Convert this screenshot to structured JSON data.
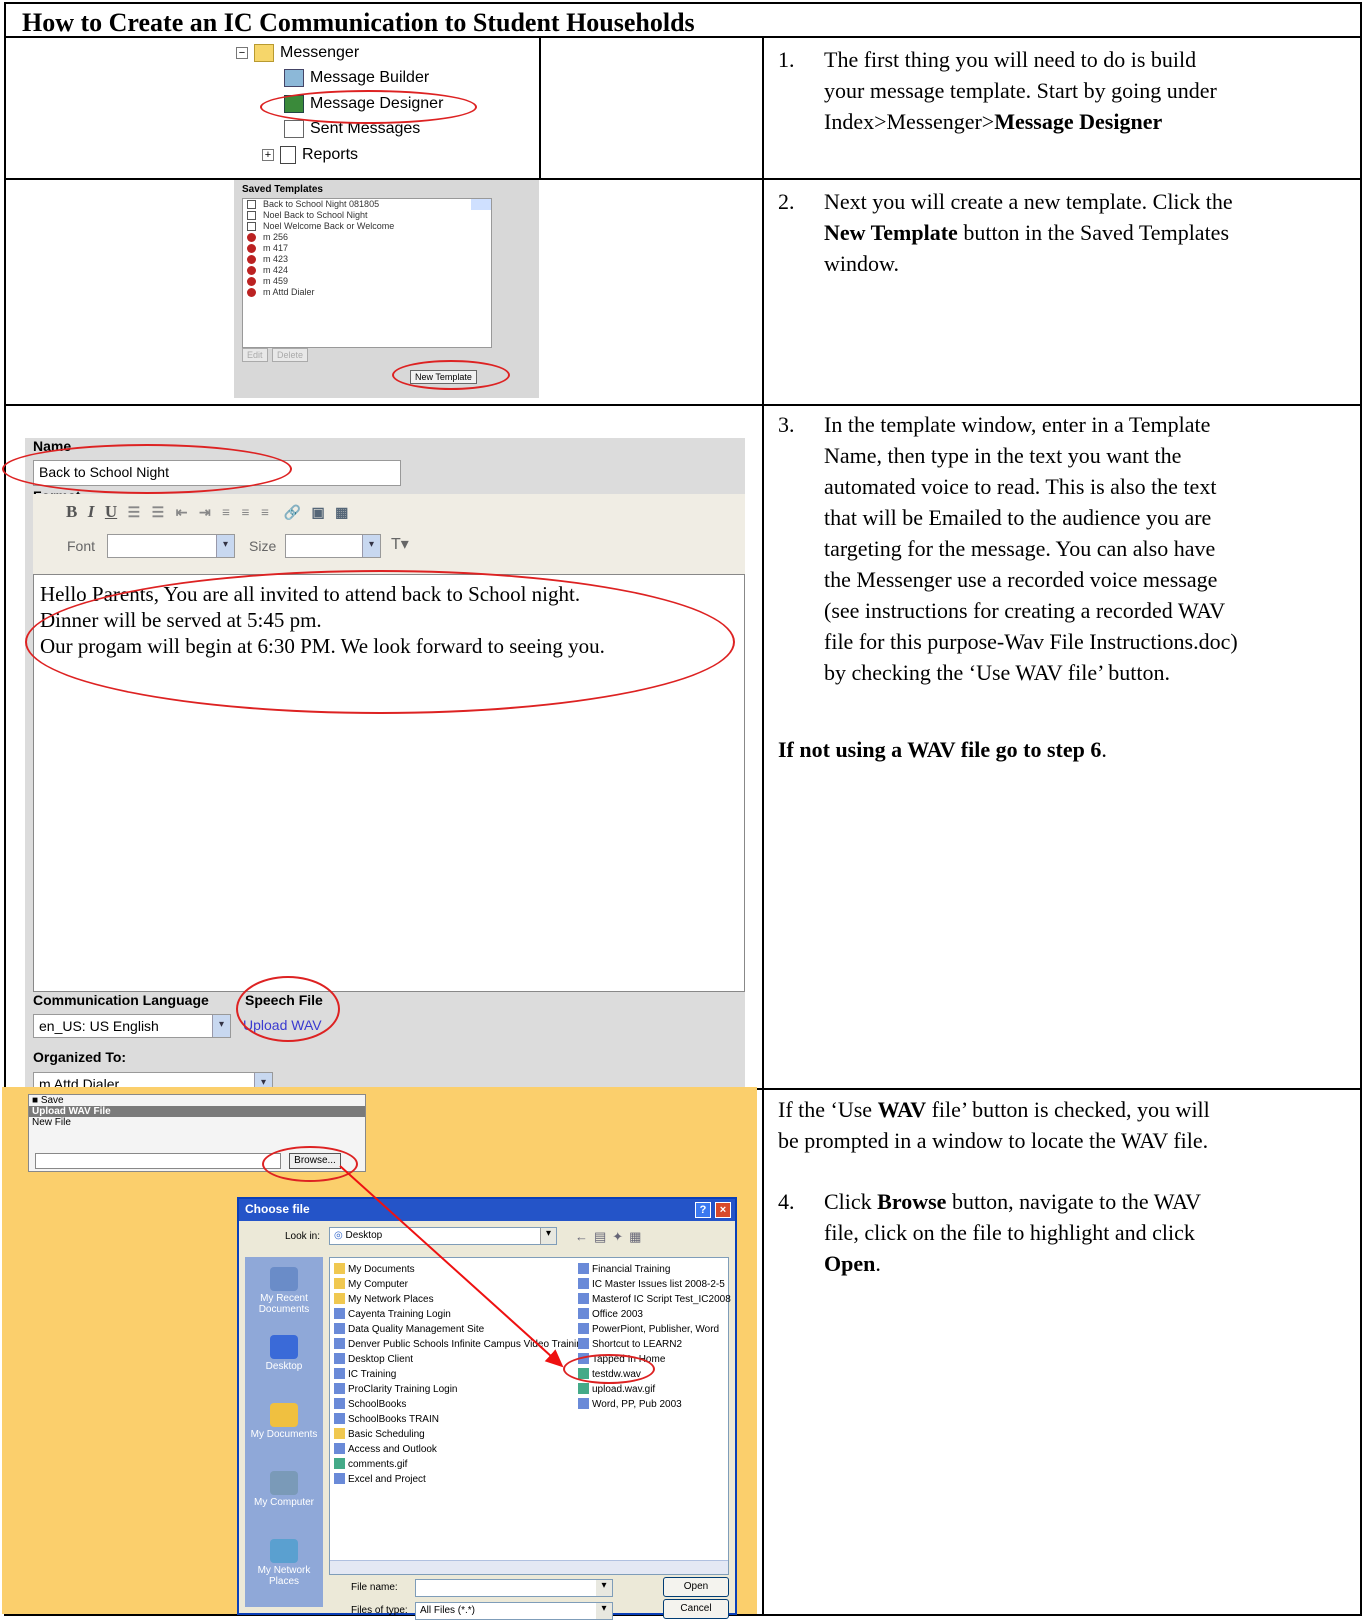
{
  "title": "How to Create an IC Communication to Student Households",
  "steps": {
    "s1": {
      "num": "1.",
      "line1": "The first thing you will need to do is build",
      "line2": "your message template.  Start by going under",
      "line3a": "Index>Messenger>",
      "line3b": "Message Designer"
    },
    "s2": {
      "num": "2.",
      "line1": "Next you will create a new template.  Click the",
      "line2b": "New Template",
      "line2a": " button in the Saved Templates",
      "line3": "window."
    },
    "s3": {
      "num": "3.",
      "lines": [
        "In the template window, enter in a Template",
        "Name, then type in the text you want the",
        "automated voice to read.  This is also the text",
        "that will be Emailed to the audience you are",
        "targeting for the message.  You can also have",
        "the Messenger use a recorded voice message",
        "(see instructions for creating a recorded WAV",
        "file for this purpose-Wav File Instructions.doc)",
        "by checking the ‘Use WAV file’ button."
      ],
      "note_bold": "If not using a WAV file go to step 6",
      "note_end": "."
    },
    "s4pre": {
      "a": "If the ‘Use ",
      "b": "WAV",
      "c": " file’ button is checked, you will",
      "line2": "be prompted in a window to locate the WAV file."
    },
    "s4": {
      "num": "4.",
      "a": "Click ",
      "b": "Browse",
      "c": " button, navigate to the WAV",
      "line2": "file, click on the file to highlight and click",
      "line3b": "Open",
      "line3c": "."
    }
  },
  "tree": {
    "messenger": "Messenger",
    "builder": "Message Builder",
    "designer": "Message Designer",
    "sent": "Sent Messages",
    "reports": "Reports"
  },
  "templates": {
    "label": "Saved Templates",
    "items": [
      "Back to School Night 081805",
      "Noel Back to School Night",
      "Noel Welcome Back or Welcome",
      "m 256",
      "m 417",
      "m 423",
      "m 424",
      "m 459",
      "m Attd Dialer"
    ],
    "edit": "Edit",
    "delete": "Delete",
    "new_template": "New Template"
  },
  "editor": {
    "name_label": "Name",
    "name_value": "Back to School Night",
    "format_label": "Format",
    "font_label": "Font",
    "size_label": "Size",
    "body": [
      "Hello Parents, You are all invited to attend back to School night.",
      "Dinner will be served at 5:45 pm.",
      "Our progam will begin at 6:30 PM. We look forward to seeing you."
    ],
    "lang_label": "Communication Language",
    "lang_value": "en_US: US English",
    "speech_label": "Speech File",
    "speech_link": "Upload WAV",
    "org_label": "Organized To:",
    "org_value": "m Attd Dialer"
  },
  "upload": {
    "save": "Save",
    "header": "Upload WAV File",
    "new_file": "New File",
    "browse": "Browse..."
  },
  "dialog": {
    "title": "Choose file",
    "look_in": "Look in:",
    "location": "Desktop",
    "places": [
      "My Recent Documents",
      "Desktop",
      "My Documents",
      "My Computer",
      "My Network Places"
    ],
    "col1": [
      "My Documents",
      "My Computer",
      "My Network Places",
      "Cayenta Training Login",
      "Data Quality Management Site",
      "Denver Public Schools Infinite Campus Video Training",
      "Desktop Client",
      "IC Training",
      "ProClarity Training Login",
      "SchoolBooks",
      "SchoolBooks TRAIN",
      "Basic Scheduling",
      "Access and Outlook",
      "comments.gif",
      "Excel and Project"
    ],
    "col2": [
      "Financial Training",
      "IC Master Issues list 2008-2-5",
      "Masterof IC Script Test_IC2008",
      "Office 2003",
      "PowerPiont, Publisher, Word",
      "Shortcut to LEARN2",
      "Tapped In Home",
      "testdw.wav",
      "upload.wav.gif",
      "Word, PP, Pub 2003"
    ],
    "file_name": "File name:",
    "files_of_type": "Files of type:",
    "type_value": "All Files (*.*)",
    "open": "Open",
    "cancel": "Cancel"
  }
}
